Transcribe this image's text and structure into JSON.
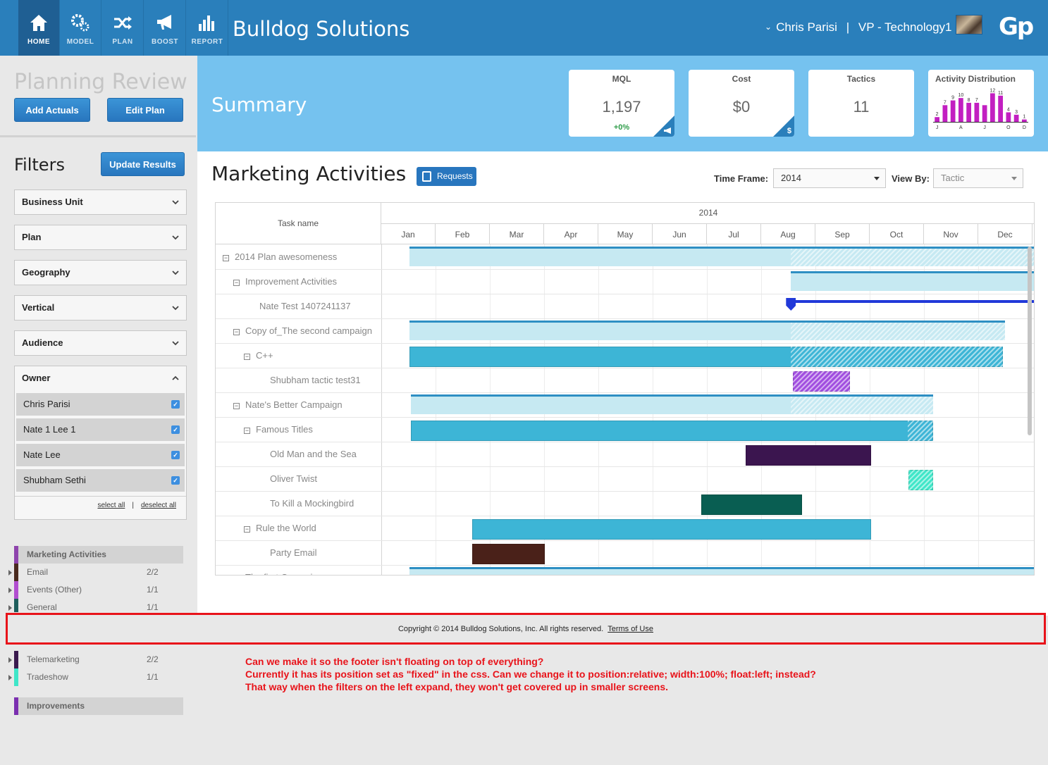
{
  "app": {
    "brand": "Bulldog Solutions",
    "user_name": "Chris Parisi",
    "user_sep": "|",
    "user_role": "VP - Technology1",
    "logo": "Gp",
    "nav": [
      {
        "label": "HOME",
        "icon": "home-icon",
        "active": true
      },
      {
        "label": "MODEL",
        "icon": "gears-icon",
        "active": false
      },
      {
        "label": "PLAN",
        "icon": "shuffle-icon",
        "active": false
      },
      {
        "label": "BOOST",
        "icon": "megaphone-icon",
        "active": false
      },
      {
        "label": "REPORT",
        "icon": "bar-chart-icon",
        "active": false
      }
    ]
  },
  "left": {
    "title": "Planning Review",
    "add_actuals": "Add Actuals",
    "edit_plan": "Edit Plan",
    "filters_title": "Filters",
    "update_results": "Update Results",
    "filters": [
      "Business Unit",
      "Plan",
      "Geography",
      "Vertical",
      "Audience"
    ],
    "owner_label": "Owner",
    "owners": [
      "Chris Parisi",
      "Nate 1 Lee 1",
      "Nate Lee",
      "Shubham Sethi"
    ],
    "select_all": "select all",
    "link_sep": "|",
    "deselect_all": "deselect all",
    "legend_group": "Marketing Activities",
    "legend_group_color": "#8e44ad",
    "legend": [
      {
        "name": "Email",
        "count": "2/2",
        "color": "#4a2a1e"
      },
      {
        "name": "Events (Other)",
        "count": "1/1",
        "color": "#b24fd0"
      },
      {
        "name": "General",
        "count": "1/1",
        "color": "#1d5d5b"
      },
      {
        "name": "Telemarketing",
        "count": "2/2",
        "color": "#3a1a4e"
      },
      {
        "name": "Tradeshow",
        "count": "1/1",
        "color": "#3fe6c8"
      }
    ],
    "improvements": "Improvements",
    "improvements_color": "#7b2fb0"
  },
  "summary": {
    "title": "Summary",
    "cards": [
      {
        "title": "MQL",
        "value": "1,197",
        "sub": "+0%",
        "corner_icon": "megaphone-icon"
      },
      {
        "title": "Cost",
        "value": "$0",
        "sub": "",
        "corner_icon": "dollar-icon"
      },
      {
        "title": "Tactics",
        "value": "11",
        "sub": ""
      }
    ],
    "activity_title": "Activity Distribution"
  },
  "chart_data": {
    "type": "bar",
    "title": "Activity Distribution",
    "categories": [
      "J",
      "F",
      "M",
      "A",
      "M",
      "J",
      "J",
      "A",
      "S",
      "O",
      "N",
      "D"
    ],
    "tick_labels": [
      "J",
      "A",
      "J",
      "O",
      "D"
    ],
    "values": [
      2,
      7,
      9,
      10,
      8,
      8,
      7,
      12,
      11,
      4,
      3,
      1
    ],
    "data_labels": [
      "2",
      "7",
      "9",
      "10",
      "8",
      "7",
      "",
      "12",
      "11",
      "4",
      "3",
      "1"
    ],
    "ylim": [
      0,
      13
    ],
    "bar_color": "#c21fc1"
  },
  "marketing": {
    "title": "Marketing Activities",
    "requests": "Requests",
    "timeframe_label": "Time Frame:",
    "timeframe_value": "2014",
    "viewby_label": "View By:",
    "viewby_value": "Tactic"
  },
  "gantt": {
    "task_header": "Task name",
    "year": "2014",
    "months": [
      "Jan",
      "Feb",
      "Mar",
      "Apr",
      "May",
      "Jun",
      "Jul",
      "Aug",
      "Sep",
      "Oct",
      "Nov",
      "Dec"
    ],
    "rows": [
      {
        "name": "2014 Plan awesomeness",
        "level": 0,
        "toggle": true,
        "bar": {
          "start": 0.0,
          "end": 11.78,
          "hatch_from": 7.03,
          "kind": "plan",
          "color": "#c6e9f2",
          "top_line": "#2e8fc3"
        }
      },
      {
        "name": "Improvement Activities",
        "level": 1,
        "toggle": true,
        "bar": {
          "start": 7.03,
          "end": 11.78,
          "hatch_from": null,
          "kind": "plan",
          "color": "#c6e9f2",
          "top_line": "#2e8fc3"
        }
      },
      {
        "name": "Nate Test 1407241137",
        "level": 2,
        "toggle": false,
        "bar": {
          "start": 7.03,
          "end": 11.78,
          "hatch_from": null,
          "kind": "line",
          "color": "#2139d9"
        }
      },
      {
        "name": "Copy of_The second campaign",
        "level": 1,
        "toggle": true,
        "bar": {
          "start": 0.0,
          "end": 10.97,
          "hatch_from": 7.03,
          "kind": "plan",
          "color": "#c6e9f2",
          "top_line": "#2e8fc3"
        }
      },
      {
        "name": "C++",
        "level": 2,
        "toggle": true,
        "bar": {
          "start": 0.0,
          "end": 10.93,
          "hatch_from": 7.03,
          "kind": "program",
          "color": "#3db5d6"
        }
      },
      {
        "name": "Shubham tactic test31",
        "level": 3,
        "toggle": false,
        "bar": {
          "start": 7.07,
          "end": 8.12,
          "hatch_from": 7.07,
          "kind": "tactic",
          "color": "#a14ee0"
        }
      },
      {
        "name": "Nate's Better Campaign",
        "level": 1,
        "toggle": true,
        "bar": {
          "start": 0.03,
          "end": 9.65,
          "hatch_from": 7.03,
          "kind": "plan",
          "color": "#c6e9f2",
          "top_line": "#2e8fc3"
        }
      },
      {
        "name": "Famous Titles",
        "level": 2,
        "toggle": true,
        "bar": {
          "start": 0.03,
          "end": 9.65,
          "hatch_from": 9.18,
          "kind": "program",
          "color": "#3db5d6"
        }
      },
      {
        "name": "Old Man and the Sea",
        "level": 3,
        "toggle": false,
        "bar": {
          "start": 6.2,
          "end": 8.51,
          "hatch_from": null,
          "kind": "tactic",
          "color": "#3b154f"
        }
      },
      {
        "name": "Oliver Twist",
        "level": 3,
        "toggle": false,
        "bar": {
          "start": 9.19,
          "end": 9.65,
          "hatch_from": 9.19,
          "kind": "tactic",
          "color": "#3fe6c8"
        }
      },
      {
        "name": "To Kill a Mockingbird",
        "level": 3,
        "toggle": false,
        "bar": {
          "start": 5.38,
          "end": 7.23,
          "hatch_from": null,
          "kind": "tactic",
          "color": "#095e52"
        }
      },
      {
        "name": "Rule the World",
        "level": 2,
        "toggle": true,
        "bar": {
          "start": 1.15,
          "end": 8.51,
          "hatch_from": null,
          "kind": "program",
          "color": "#3db5d6"
        }
      },
      {
        "name": "Party Email",
        "level": 3,
        "toggle": false,
        "bar": {
          "start": 1.15,
          "end": 2.5,
          "hatch_from": null,
          "kind": "tactic",
          "color": "#4a2119"
        }
      },
      {
        "name": "The first Campaign",
        "level": 1,
        "toggle": true,
        "bar": {
          "start": 0.0,
          "end": 11.78,
          "hatch_from": null,
          "kind": "plan",
          "color": "#c6e9f2",
          "top_line": "#2e8fc3"
        }
      }
    ]
  },
  "footer": {
    "copyright": "Copyright © 2014 Bulldog Solutions, Inc. All rights reserved.",
    "terms": "Terms of Use"
  },
  "note": {
    "lines": [
      "Can we make it so the footer isn't floating on top of everything?",
      "Currently it has its position set as \"fixed\" in the css. Can we change it to position:relative; width:100%; float:left; instead?",
      "That way when the filters on the left expand, they won't get covered up in smaller screens."
    ]
  }
}
